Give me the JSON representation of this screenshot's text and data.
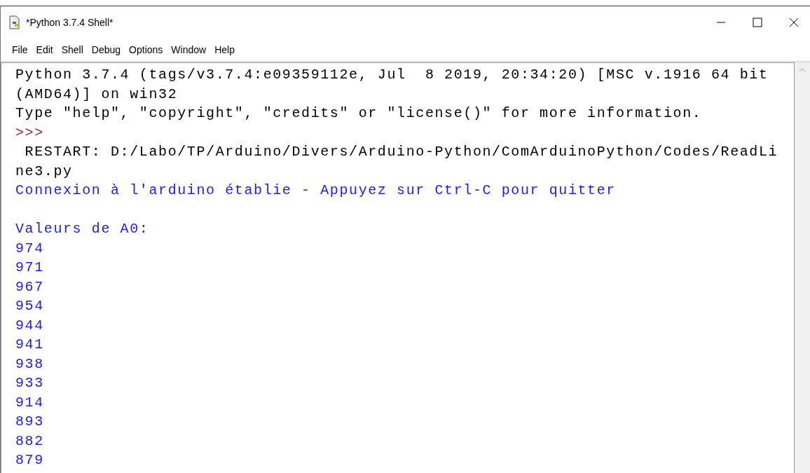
{
  "window": {
    "title": "*Python 3.7.4 Shell*"
  },
  "menu": [
    "File",
    "Edit",
    "Shell",
    "Debug",
    "Options",
    "Window",
    "Help"
  ],
  "shell_lines": [
    {
      "kind": "output",
      "text": "Python 3.7.4 (tags/v3.7.4:e09359112e, Jul  8 2019, 20:34:20) [MSC v.1916 64 bit"
    },
    {
      "kind": "output",
      "text": "(AMD64)] on win32"
    },
    {
      "kind": "output",
      "text": "Type \"help\", \"copyright\", \"credits\" or \"license()\" for more information."
    },
    {
      "kind": "prompt",
      "text": ">>>"
    },
    {
      "kind": "output",
      "text": " RESTART: D:/Labo/TP/Arduino/Divers/Arduino-Python/ComArduinoPython/Codes/ReadLi"
    },
    {
      "kind": "output",
      "text": "ne3.py"
    },
    {
      "kind": "stdout",
      "text": "Connexion à l'arduino établie - Appuyez sur Ctrl-C pour quitter"
    },
    {
      "kind": "stdout",
      "text": "Valeurs de A0:",
      "blank_before": true
    },
    {
      "kind": "stdout",
      "text": "974"
    },
    {
      "kind": "stdout",
      "text": "971"
    },
    {
      "kind": "stdout",
      "text": "967"
    },
    {
      "kind": "stdout",
      "text": "954"
    },
    {
      "kind": "stdout",
      "text": "944"
    },
    {
      "kind": "stdout",
      "text": "941"
    },
    {
      "kind": "stdout",
      "text": "938"
    },
    {
      "kind": "stdout",
      "text": "933"
    },
    {
      "kind": "stdout",
      "text": "914"
    },
    {
      "kind": "stdout",
      "text": "893"
    },
    {
      "kind": "stdout",
      "text": "882"
    },
    {
      "kind": "stdout",
      "text": "879"
    }
  ]
}
